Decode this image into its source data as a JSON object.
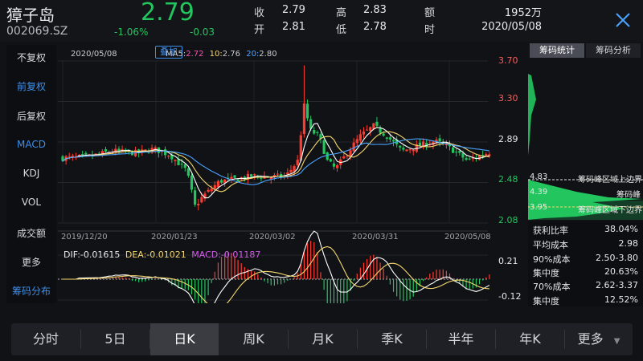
{
  "quote": {
    "name": "獐子岛",
    "code": "002069.SZ",
    "price": "2.79",
    "change_pct": "-1.06%",
    "change_abs": "-0.03",
    "fields": [
      {
        "label": "收",
        "value": "2.79"
      },
      {
        "label": "开",
        "value": "2.81"
      },
      {
        "label": "高",
        "value": "2.83"
      },
      {
        "label": "低",
        "value": "2.78"
      },
      {
        "label": "额",
        "value": "1952万"
      },
      {
        "label": "时",
        "value": "2020/05/08"
      }
    ]
  },
  "sidebar": {
    "items": [
      {
        "label": "不复权",
        "active": false
      },
      {
        "label": "前复权",
        "active": true
      },
      {
        "label": "后复权",
        "active": false
      },
      {
        "label": "MACD",
        "active": true
      },
      {
        "label": "KDJ",
        "active": false
      },
      {
        "label": "VOL",
        "active": false
      },
      {
        "label": "成交额",
        "active": false
      },
      {
        "label": "更多",
        "active": false
      },
      {
        "label": "筹码分布",
        "active": true
      }
    ]
  },
  "chart": {
    "date_label": "2020/05/08",
    "overlay_button": "叠加",
    "ma_legend": [
      {
        "label": "MA5:",
        "value": "2.72",
        "color": "#ff4fb8"
      },
      {
        "label": "10:",
        "value": "2.76",
        "color": "#f5d76e"
      },
      {
        "label": "20:",
        "value": "2.80",
        "color": "#4aa3ff"
      }
    ],
    "price_axis": [
      "3.70",
      "3.30",
      "2.89",
      "2.48",
      "2.08"
    ],
    "date_axis": [
      "2019/12/20",
      "2020/01/23",
      "2020/03/02",
      "2020/03/31",
      "2020/05/08"
    ],
    "macd_legend": {
      "dif": "DIF:-0.01615",
      "dea": "DEA:-0.01021",
      "macd": "MACD:-0.01187"
    },
    "macd_axis": [
      "0.21",
      "-0.12"
    ]
  },
  "chart_data": {
    "type": "candlestick",
    "ylim": [
      2.08,
      3.7
    ],
    "x_labels": [
      "2019/12/20",
      "2020/01/23",
      "2020/03/02",
      "2020/03/31",
      "2020/05/08"
    ],
    "current_close": 2.89
  },
  "chip_panel": {
    "tabs": [
      "筹码统计",
      "筹码分析"
    ],
    "levels": [
      {
        "price": "4.83",
        "label": "筹码峰区域上边界"
      },
      {
        "price": "4.39",
        "label": "筹码峰"
      },
      {
        "price": "3.95",
        "label": "筹码峰区域下边界"
      }
    ],
    "stats": [
      {
        "label": "获利比率",
        "value": "38.04%"
      },
      {
        "label": "平均成本",
        "value": "2.98"
      },
      {
        "label": "90%成本",
        "value": "2.50-3.80"
      },
      {
        "label": "集中度",
        "value": "20.63%"
      },
      {
        "label": "70%成本",
        "value": "2.62-3.37"
      },
      {
        "label": "集中度",
        "value": "12.52%"
      }
    ]
  },
  "period_tabs": [
    {
      "label": "分时",
      "active": false
    },
    {
      "label": "5日",
      "active": false
    },
    {
      "label": "日K",
      "active": true
    },
    {
      "label": "周K",
      "active": false
    },
    {
      "label": "月K",
      "active": false
    },
    {
      "label": "季K",
      "active": false
    },
    {
      "label": "半年",
      "active": false
    },
    {
      "label": "年K",
      "active": false
    },
    {
      "label": "更多",
      "active": false
    }
  ]
}
